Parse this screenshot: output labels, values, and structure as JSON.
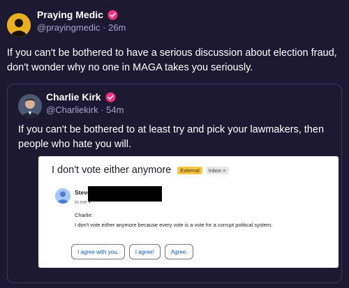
{
  "post": {
    "author_name": "Praying Medic",
    "handle_time": "@prayingmedic · 26m",
    "text": "If you can't be bothered to have a serious discussion about election fraud, don't wonder why no one in MAGA takes you seriously."
  },
  "quoted": {
    "author_name": "Charlie Kirk",
    "handle_time": "@Charliekirk · 54m",
    "text": "If you can't be bothered to at least try and pick your lawmakers, then people who hate you will."
  },
  "email": {
    "subject": "I don't vote either anymore",
    "tag_external": "External",
    "tag_inbox": "Inbox ×",
    "sender": "Steve",
    "to_me": "to me ▾",
    "greeting": "Charlie:",
    "body": "I don't vote either anymore because every vote is a vote for a corrupt political system.",
    "smart_replies": [
      "I agree with you.",
      "I agree!",
      "Agree."
    ]
  },
  "colors": {
    "background": "#1d1933",
    "verified_badge": "#f0307a",
    "reply_blue": "#0b57d0",
    "external_tag": "#f4c542"
  },
  "icons": {
    "verified": "verified-badge-icon",
    "dropdown": "chevron-down-icon"
  }
}
